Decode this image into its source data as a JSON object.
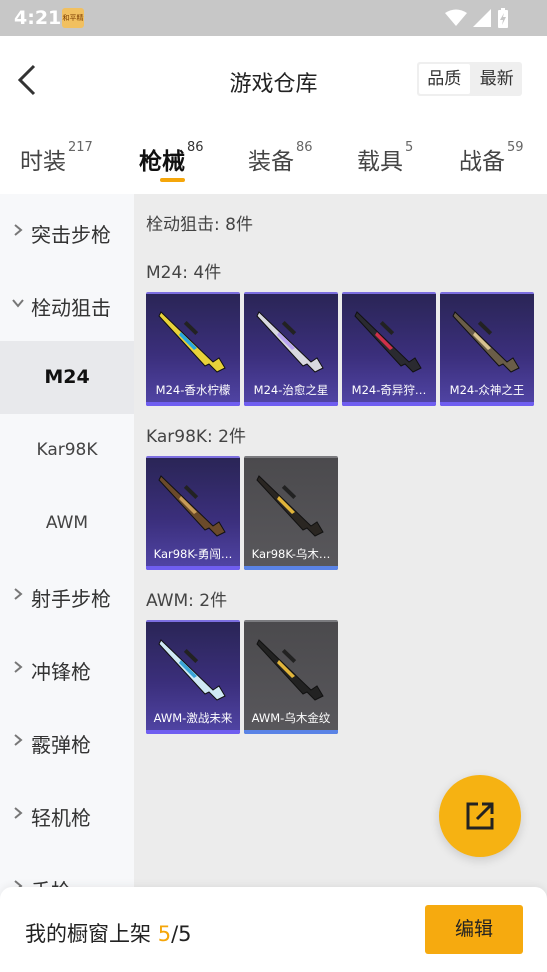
{
  "status": {
    "time": "4:21",
    "app_icon_text": "和平精英"
  },
  "header": {
    "title": "游戏仓库",
    "sort_quality": "品质",
    "sort_latest": "最新"
  },
  "tabs": [
    {
      "label": "时装",
      "count": "217"
    },
    {
      "label": "枪械",
      "count": "86"
    },
    {
      "label": "装备",
      "count": "86"
    },
    {
      "label": "载具",
      "count": "5"
    },
    {
      "label": "战备",
      "count": "59"
    }
  ],
  "sidebar": {
    "items": [
      {
        "label": "突击步枪"
      },
      {
        "label": "栓动狙击"
      },
      {
        "label": "M24"
      },
      {
        "label": "Kar98K"
      },
      {
        "label": "AWM"
      },
      {
        "label": "射手步枪"
      },
      {
        "label": "冲锋枪"
      },
      {
        "label": "霰弹枪"
      },
      {
        "label": "轻机枪"
      },
      {
        "label": "手枪"
      }
    ]
  },
  "main": {
    "summary": "栓动狙击: 8件",
    "groups": [
      {
        "heading": "M24: 4件",
        "items": [
          {
            "name": "M24-香水柠檬",
            "rarity": "purple",
            "gun_color": "#e8d23a",
            "accent": "#27a9e0"
          },
          {
            "name": "M24-治愈之星",
            "rarity": "purple",
            "gun_color": "#d9d9e0",
            "accent": "#b9a4f0"
          },
          {
            "name": "M24-奇异狩…",
            "rarity": "purple",
            "gun_color": "#2a2a30",
            "accent": "#d0304a"
          },
          {
            "name": "M24-众神之王",
            "rarity": "purple",
            "gun_color": "#6a5d48",
            "accent": "#d7c190"
          }
        ]
      },
      {
        "heading": "Kar98K: 2件",
        "items": [
          {
            "name": "Kar98K-勇闯…",
            "rarity": "purple",
            "gun_color": "#6b4a2a",
            "accent": "#c69a58"
          },
          {
            "name": "Kar98K-乌木…",
            "rarity": "gray",
            "gun_color": "#2a2622",
            "accent": "#e0b43a"
          }
        ]
      },
      {
        "heading": "AWM: 2件",
        "items": [
          {
            "name": "AWM-激战未来",
            "rarity": "purple",
            "gun_color": "#cfe9f5",
            "accent": "#3aa6d8"
          },
          {
            "name": "AWM-乌木金纹",
            "rarity": "gray",
            "gun_color": "#222",
            "accent": "#e0b43a"
          }
        ]
      }
    ]
  },
  "bottom": {
    "label": "我的橱窗上架 ",
    "current": "5",
    "total": "/5",
    "edit": "编辑"
  }
}
